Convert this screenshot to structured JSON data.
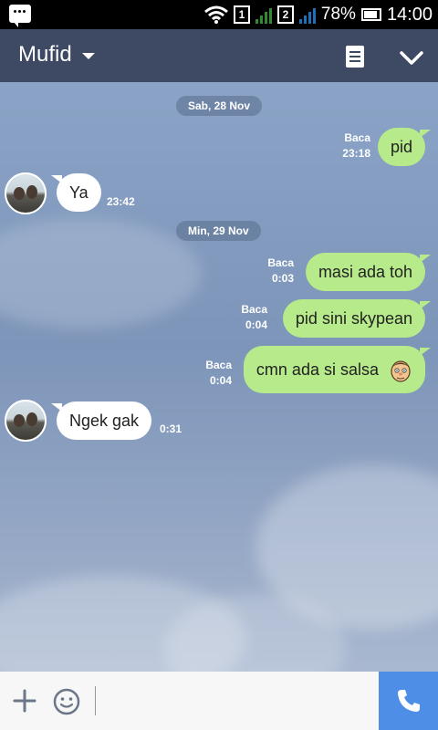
{
  "status_bar": {
    "sim1": "1",
    "sim2": "2",
    "battery": "78%",
    "time": "14:00"
  },
  "header": {
    "title": "Mufid"
  },
  "messages": [
    {
      "type": "date",
      "text": "Sab, 28 Nov"
    },
    {
      "type": "out",
      "text": "pid",
      "read": "Baca",
      "time": "23:18"
    },
    {
      "type": "in",
      "text": "Ya",
      "time": "23:42"
    },
    {
      "type": "date",
      "text": "Min, 29 Nov"
    },
    {
      "type": "out",
      "text": "masi ada toh",
      "read": "Baca",
      "time": "0:03"
    },
    {
      "type": "out",
      "text": "pid sini skypean",
      "read": "Baca",
      "time": "0:04"
    },
    {
      "type": "out",
      "text": "cmn ada si salsa",
      "read": "Baca",
      "time": "0:04",
      "emoji": "face-emoji-icon"
    },
    {
      "type": "in",
      "text": "Ngek gak",
      "time": "0:31"
    }
  ],
  "colors": {
    "header_bg": "#3e4a63",
    "outgoing_bubble": "#b7ea8a",
    "incoming_bubble": "#ffffff",
    "call_button": "#4f8ee6"
  },
  "icons": [
    "bbm-icon",
    "wifi-icon",
    "signal-icon",
    "battery-icon",
    "dropdown-caret-icon",
    "note-icon",
    "chevron-down-icon",
    "plus-icon",
    "emoji-icon",
    "phone-icon"
  ]
}
